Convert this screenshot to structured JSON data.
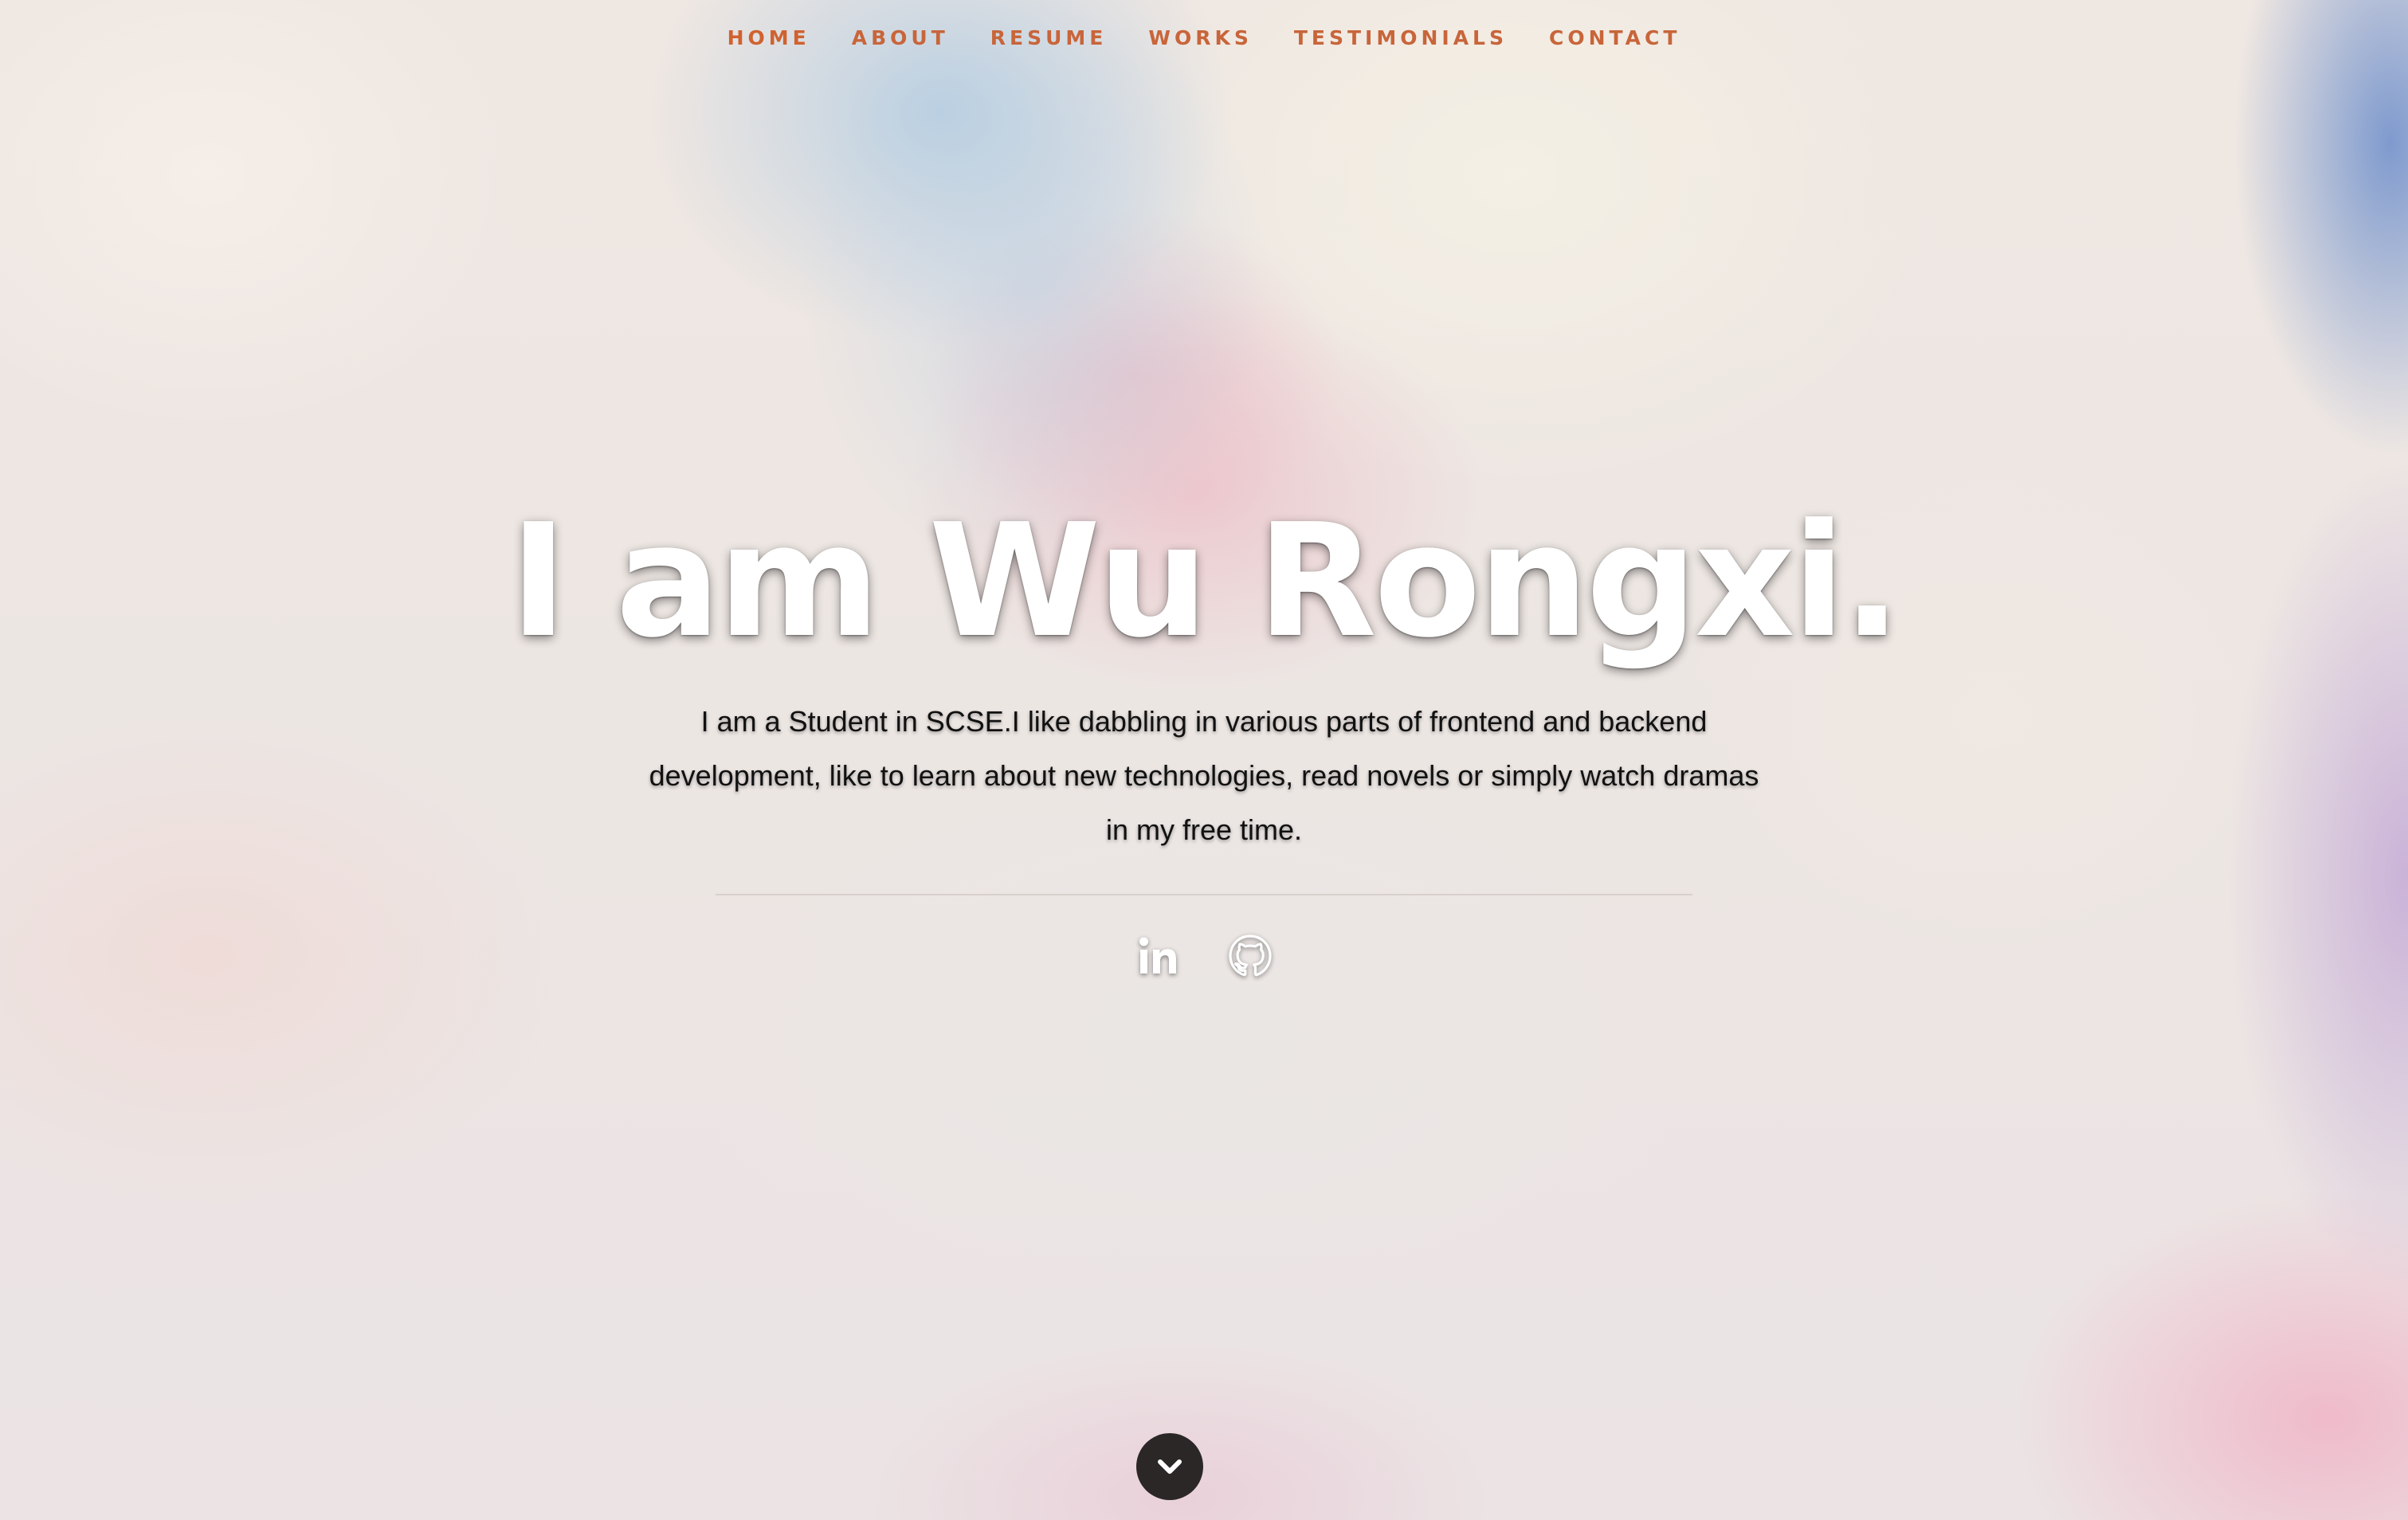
{
  "nav": {
    "items": [
      {
        "label": "HOME",
        "current": true
      },
      {
        "label": "ABOUT"
      },
      {
        "label": "RESUME"
      },
      {
        "label": "WORKS"
      },
      {
        "label": "TESTIMONIALS"
      },
      {
        "label": "CONTACT"
      }
    ]
  },
  "hero": {
    "title": "I am Wu Rongxi.",
    "description": "I am a Student in SCSE.I like dabbling in various parts of frontend and backend development, like to learn about new technologies, read novels or simply watch dramas in my free time."
  },
  "social": {
    "icons": [
      "linkedin-icon",
      "github-icon"
    ]
  },
  "scroll_down": {
    "icon": "chevron-down-icon"
  },
  "colors": {
    "nav_text": "#c8653a",
    "title_text": "#ffffff",
    "body_text": "#111111",
    "scroll_button": "#2b2727"
  }
}
